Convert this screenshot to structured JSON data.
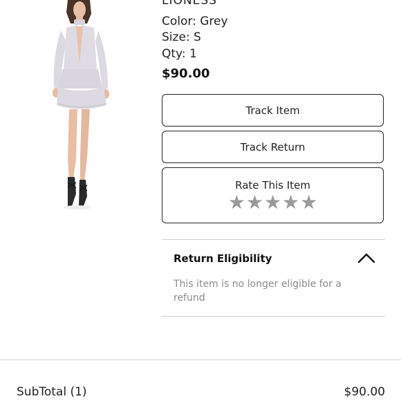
{
  "product": {
    "brand": "LIONESS",
    "color": "Color: Grey",
    "size": "Size: S",
    "qty": "Qty: 1",
    "price": "$90.00",
    "image_icon": "grey-ruffle-dress-model-image"
  },
  "actions": {
    "track_item": "Track Item",
    "track_return": "Track Return",
    "rate_item": "Rate This Item",
    "rating_stars": [
      "★",
      "★",
      "★",
      "★",
      "★"
    ],
    "rating_value": 0,
    "star_color": "#9a9a9a"
  },
  "return_eligibility": {
    "title": "Return Eligibility",
    "message": "This item is no longer eligible for a refund",
    "toggle_icon": "chevron-up-icon"
  },
  "summary": {
    "subtotal_label": "SubTotal (1)",
    "subtotal_value": "$90.00"
  }
}
